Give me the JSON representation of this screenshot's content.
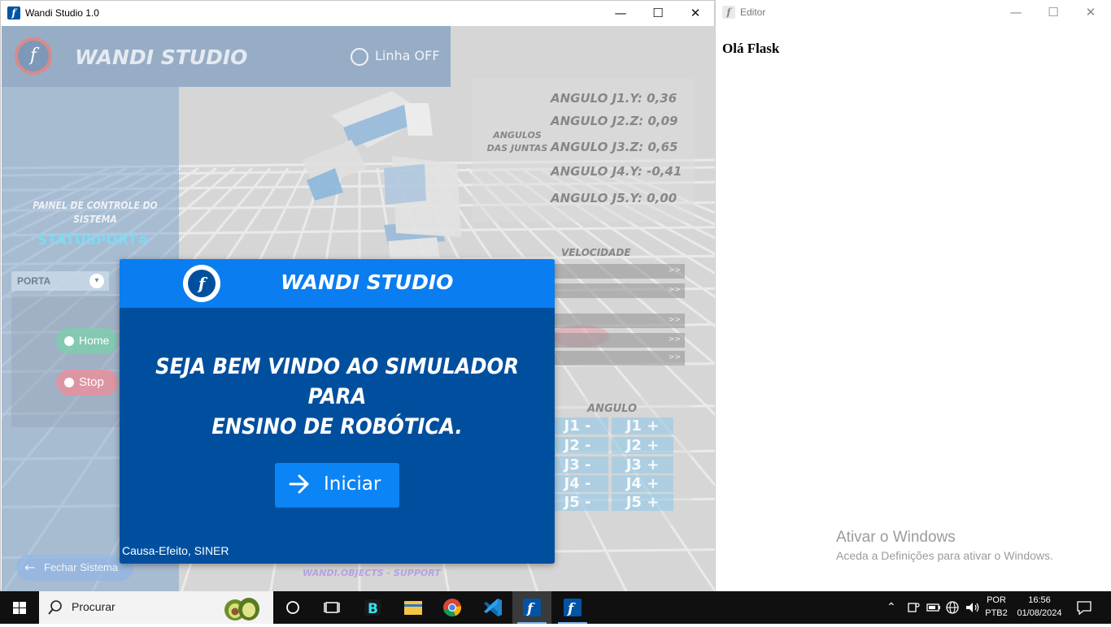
{
  "window_main": {
    "title": "Wandi Studio 1.0",
    "controls": {
      "minimize": "—",
      "maximize": "☐",
      "close": "✕"
    }
  },
  "app": {
    "brand": "WANDI STUDIO",
    "line_status": "Linha OFF",
    "panel_title": "PAINEL DE CONTROLE DO SISTEMA",
    "status_port": "STATUSPORT#",
    "port_select": {
      "selected": "PORTA"
    },
    "home_button": "Home",
    "stop_button": "Stop",
    "close_system_button": "Fechar Sistema",
    "support_link": "WANDI.OBJECTS - SUPPORT",
    "angles_title": "ANGULOS DAS JUNTAS",
    "angles": [
      {
        "label": "ANGULO J1.Y: 0,36"
      },
      {
        "label": "ANGULO J2.Z: 0,09"
      },
      {
        "label": "ANGULO J3.Z: 0,65"
      },
      {
        "label": "ANGULO J4.Y: -0,41"
      },
      {
        "label": "ANGULO J5.Y: 0,00"
      }
    ],
    "speed_title": "VELOCIDADE",
    "slider_arrow": ">>",
    "angle_box_title": "ANGULO",
    "joint_buttons": [
      {
        "minus": "J1 -",
        "plus": "J1 +"
      },
      {
        "minus": "J2 -",
        "plus": "J2 +"
      },
      {
        "minus": "J3 -",
        "plus": "J3 +"
      },
      {
        "minus": "J4 -",
        "plus": "J4 +"
      },
      {
        "minus": "J5 -",
        "plus": "J5 +"
      }
    ]
  },
  "modal": {
    "title": "WANDI STUDIO",
    "message_line1": "SEJA BEM VINDO AO SIMULADOR PARA",
    "message_line2": "ENSINO DE ROBÓTICA.",
    "start_button": "Iniciar",
    "footer": "Causa-Efeito, SINER"
  },
  "window_editor": {
    "title": "Editor",
    "heading": "Olá Flask",
    "activation_title": "Ativar o Windows",
    "activation_subtitle": "Aceda a Definições para ativar o Windows."
  },
  "taskbar": {
    "search_placeholder": "Procurar",
    "language": "POR",
    "keyboard": "PTB2",
    "time": "16:56",
    "date": "01/08/2024"
  },
  "colors": {
    "modal_body": "#004f9e",
    "modal_header": "#0a7df0",
    "accent_button": "#0b84f5",
    "taskbar": "#101010"
  }
}
